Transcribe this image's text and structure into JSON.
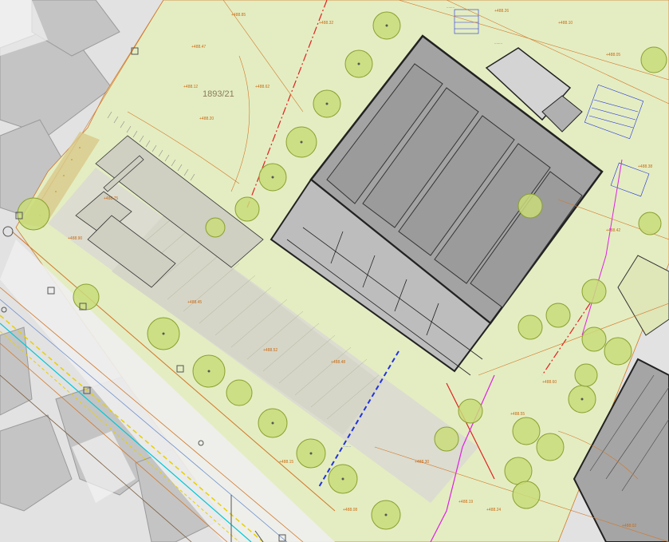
{
  "map": {
    "parcel_number": "1893/21",
    "colors": {
      "background_aerial": "#dedede",
      "plot_green": "#e4edc2",
      "building_roof": "#9d9d9d",
      "building_outline": "#222222",
      "tree_fill": "#c9dc7a",
      "tree_stroke": "#8aa030",
      "survey_lines": "#d2782a",
      "utility_blue": "#2233dd",
      "road_yellow": "#e8d000",
      "utility_cyan": "#00c8d8",
      "utility_magenta": "#e020e0",
      "section_red": "#e02020"
    },
    "icons": [
      "tree-symbol",
      "survey-point",
      "manhole-symbol"
    ]
  }
}
